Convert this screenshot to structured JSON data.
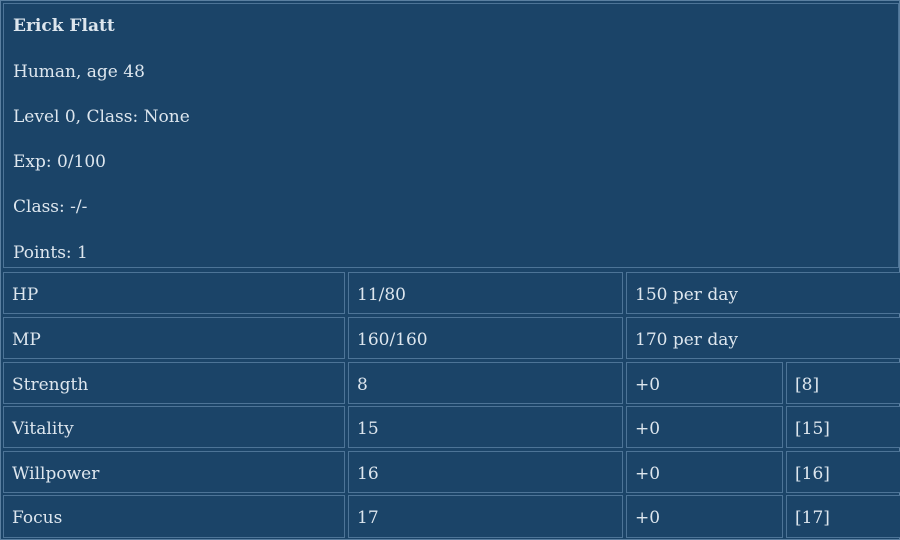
{
  "character": {
    "name": "Erick Flatt",
    "race_age": "Human, age 48",
    "level_class": "Level 0, Class: None",
    "exp": "Exp: 0/100",
    "class_line": "Class: -/-",
    "points": "Points: 1"
  },
  "resources": [
    {
      "label": "HP",
      "value": "11/80",
      "regen": "150 per day"
    },
    {
      "label": "MP",
      "value": "160/160",
      "regen": "170 per day"
    }
  ],
  "stats": [
    {
      "label": "Strength",
      "value": "8",
      "modifier": "+0",
      "total": "[8]"
    },
    {
      "label": "Vitality",
      "value": "15",
      "modifier": "+0",
      "total": "[15]"
    },
    {
      "label": "Willpower",
      "value": "16",
      "modifier": "+0",
      "total": "[16]"
    },
    {
      "label": "Focus",
      "value": "17",
      "modifier": "+0",
      "total": "[17]"
    }
  ],
  "colors": {
    "background": "#1b4468",
    "border": "#4d7497",
    "text": "#dde6ee"
  }
}
